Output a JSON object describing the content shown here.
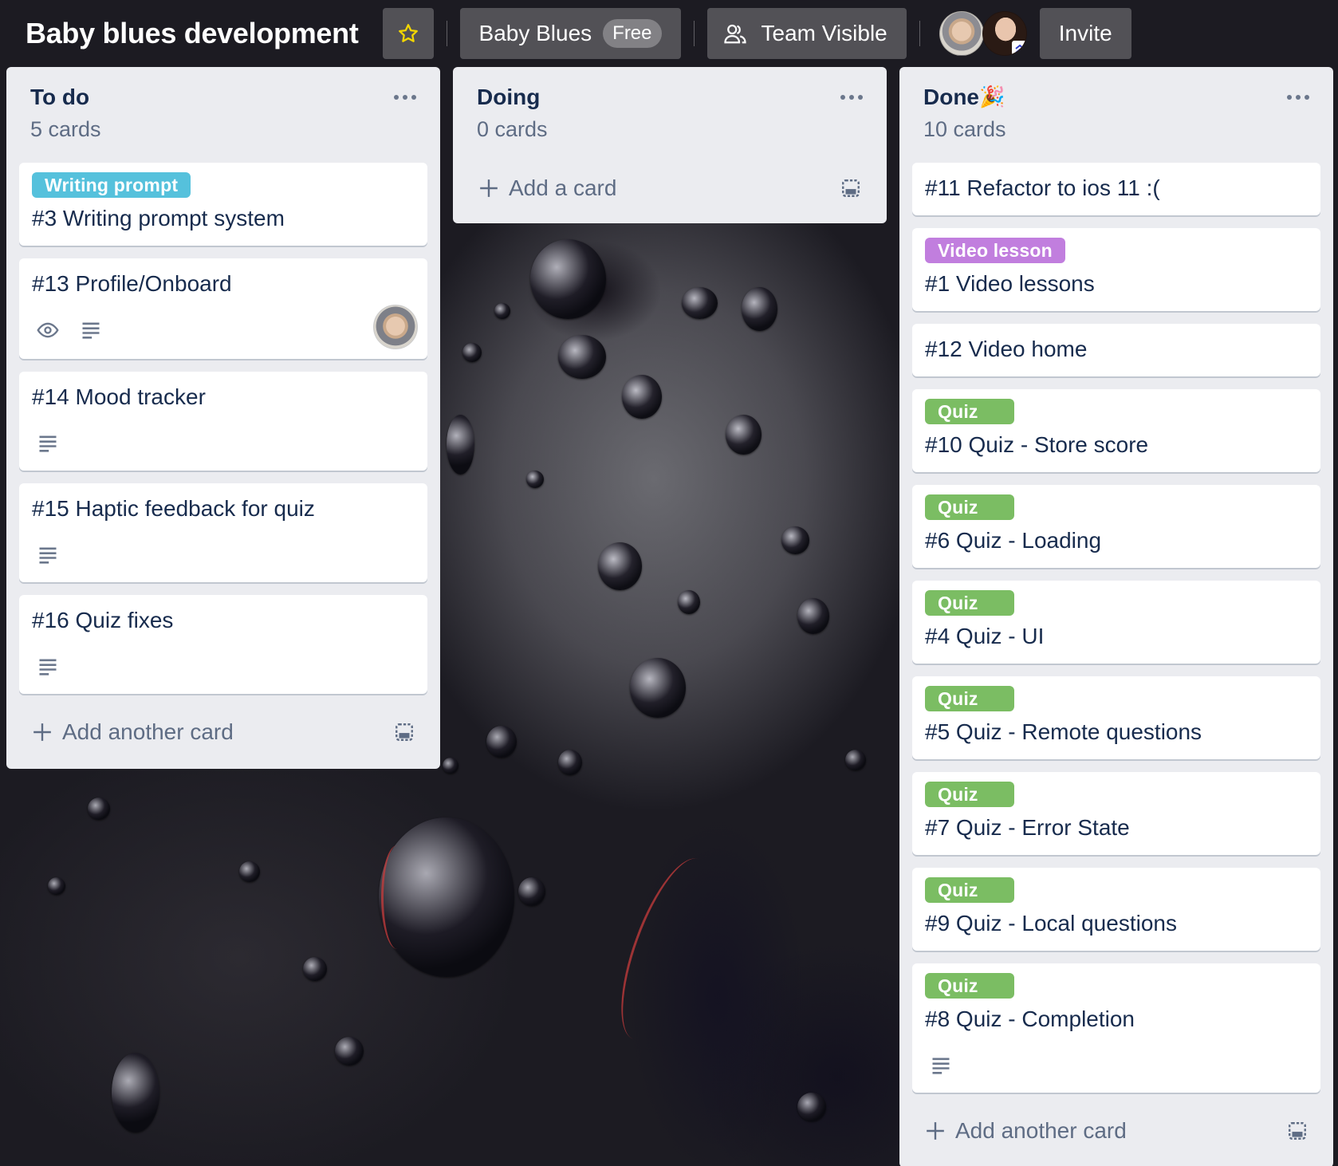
{
  "board": {
    "title": "Baby blues development",
    "team_name": "Baby Blues",
    "plan_badge": "Free",
    "visibility": "Team Visible",
    "invite_label": "Invite",
    "members": [
      "member-1",
      "member-2"
    ]
  },
  "colors": {
    "label_blue": "#55c1dc",
    "label_purple": "#c17ede",
    "label_green": "#7bbd63",
    "star": "#f2d600"
  },
  "lists": [
    {
      "title": "To do",
      "count": "5 cards",
      "add_label": "Add another card",
      "cards": [
        {
          "label": "Writing prompt",
          "label_color": "blue",
          "title": "#3 Writing prompt system"
        },
        {
          "title": "#13 Profile/Onboard",
          "badges": [
            "eye-icon",
            "description-icon"
          ],
          "member": true
        },
        {
          "title": "#14 Mood tracker",
          "badges": [
            "description-icon"
          ]
        },
        {
          "title": "#15 Haptic feedback for quiz",
          "badges": [
            "description-icon"
          ]
        },
        {
          "title": "#16 Quiz fixes",
          "badges": [
            "description-icon"
          ]
        }
      ]
    },
    {
      "title": "Doing",
      "count": "0 cards",
      "add_label": "Add a card",
      "cards": []
    },
    {
      "title": "Done",
      "title_emoji": "🎉",
      "count": "10 cards",
      "add_label": "Add another card",
      "cards": [
        {
          "title": "#11 Refactor to ios 11 :("
        },
        {
          "label": "Video lesson",
          "label_color": "purple",
          "title": "#1 Video lessons"
        },
        {
          "title": "#12 Video home"
        },
        {
          "label": "Quiz",
          "label_color": "green",
          "title": "#10 Quiz - Store score"
        },
        {
          "label": "Quiz",
          "label_color": "green",
          "title": "#6 Quiz - Loading"
        },
        {
          "label": "Quiz",
          "label_color": "green",
          "title": "#4 Quiz - UI"
        },
        {
          "label": "Quiz",
          "label_color": "green",
          "title": "#5 Quiz - Remote questions"
        },
        {
          "label": "Quiz",
          "label_color": "green",
          "title": "#7 Quiz - Error State"
        },
        {
          "label": "Quiz",
          "label_color": "green",
          "title": "#9 Quiz - Local questions"
        },
        {
          "label": "Quiz",
          "label_color": "green",
          "title": "#8 Quiz - Completion",
          "badges": [
            "description-icon"
          ]
        }
      ]
    }
  ]
}
